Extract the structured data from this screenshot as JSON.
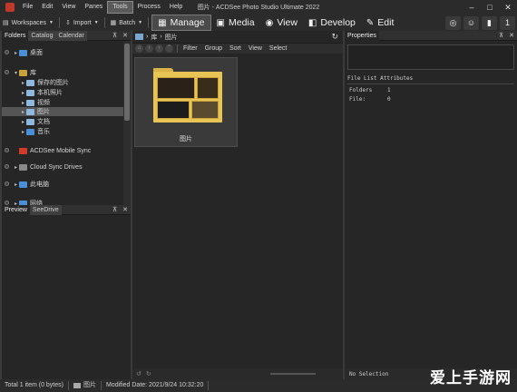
{
  "window": {
    "title": "图片 - ACDSee Photo Studio Ultimate 2022",
    "menu": [
      "File",
      "Edit",
      "View",
      "Panes",
      "Tools",
      "Process",
      "Help"
    ],
    "active_menu": "Tools",
    "controls": [
      "–",
      "□",
      "✕"
    ]
  },
  "toolbar": {
    "workspaces_label": "Workspaces",
    "import_label": "Import",
    "batch_label": "Batch",
    "modes": [
      {
        "label": "Manage",
        "icon": "grid-icon",
        "glyph": "▦",
        "active": true
      },
      {
        "label": "Media",
        "icon": "media-icon",
        "glyph": "▣",
        "active": false
      },
      {
        "label": "View",
        "icon": "eye-icon",
        "glyph": "◉",
        "active": false
      },
      {
        "label": "Develop",
        "icon": "develop-icon",
        "glyph": "◧",
        "active": false
      },
      {
        "label": "Edit",
        "icon": "edit-icon",
        "glyph": "✎",
        "active": false
      }
    ],
    "right_icons": [
      "365-icon",
      "emoji-icon",
      "chart-icon",
      "notification-icon"
    ],
    "notification_count": "1"
  },
  "folders_panel": {
    "tabs": [
      "Folders",
      "Catalog",
      "Calendar"
    ],
    "active_tab": "Folders",
    "items": [
      {
        "label": "桌面",
        "arrow": "▸",
        "indent": 1,
        "color": "#4a90d9",
        "pin": true
      },
      {
        "label": "库",
        "arrow": "▾",
        "indent": 1,
        "color": "#c9a23c",
        "pin": true
      },
      {
        "label": "保存的图片",
        "arrow": "▸",
        "indent": 2,
        "color": "#8fb8e0",
        "pin": false
      },
      {
        "label": "本机照片",
        "arrow": "▸",
        "indent": 2,
        "color": "#8fb8e0",
        "pin": false
      },
      {
        "label": "视频",
        "arrow": "▸",
        "indent": 2,
        "color": "#8fb8e0",
        "pin": false
      },
      {
        "label": "图片",
        "arrow": "▸",
        "indent": 2,
        "color": "#8fb8e0",
        "pin": false,
        "selected": true
      },
      {
        "label": "文档",
        "arrow": "▸",
        "indent": 2,
        "color": "#8fb8e0",
        "pin": false
      },
      {
        "label": "音乐",
        "arrow": "▸",
        "indent": 2,
        "color": "#4a90d9",
        "pin": false
      },
      {
        "label": "ACDSee Mobile Sync",
        "arrow": "",
        "indent": 1,
        "color": "#d23a2a",
        "pin": true
      },
      {
        "label": "Cloud Sync Drives",
        "arrow": "▸",
        "indent": 1,
        "color": "#8a8a8a",
        "pin": true
      },
      {
        "label": "此电脑",
        "arrow": "▸",
        "indent": 1,
        "color": "#4a90d9",
        "pin": true
      },
      {
        "label": "网络",
        "arrow": "▸",
        "indent": 1,
        "color": "#4a90d9",
        "pin": true
      }
    ]
  },
  "preview_panel": {
    "tabs": [
      "Preview",
      "SeeDrive"
    ],
    "active_tab": "Preview"
  },
  "browser": {
    "breadcrumb": [
      "库",
      "图片"
    ],
    "filter_items": [
      "Filter",
      "Group",
      "Sort",
      "View",
      "Select"
    ],
    "folder_thumb_label": "图片"
  },
  "properties_panel": {
    "title": "Properties",
    "section": "File List Attributes",
    "rows": [
      {
        "key": "Folders",
        "value": "1"
      },
      {
        "key": "File:",
        "value": "0"
      }
    ],
    "footer": "No Selection"
  },
  "statusbar": {
    "total": "Total 1 item  (0 bytes)",
    "selected_name": "图片",
    "modified": "Modified Date: 2021/9/24 10:32:20"
  },
  "watermark": "爱上手游网",
  "colors": {
    "accent_folder": "#e7c453",
    "panel_bg": "#262626",
    "chrome_bg": "#2b2b2b",
    "selection": "#555555"
  }
}
